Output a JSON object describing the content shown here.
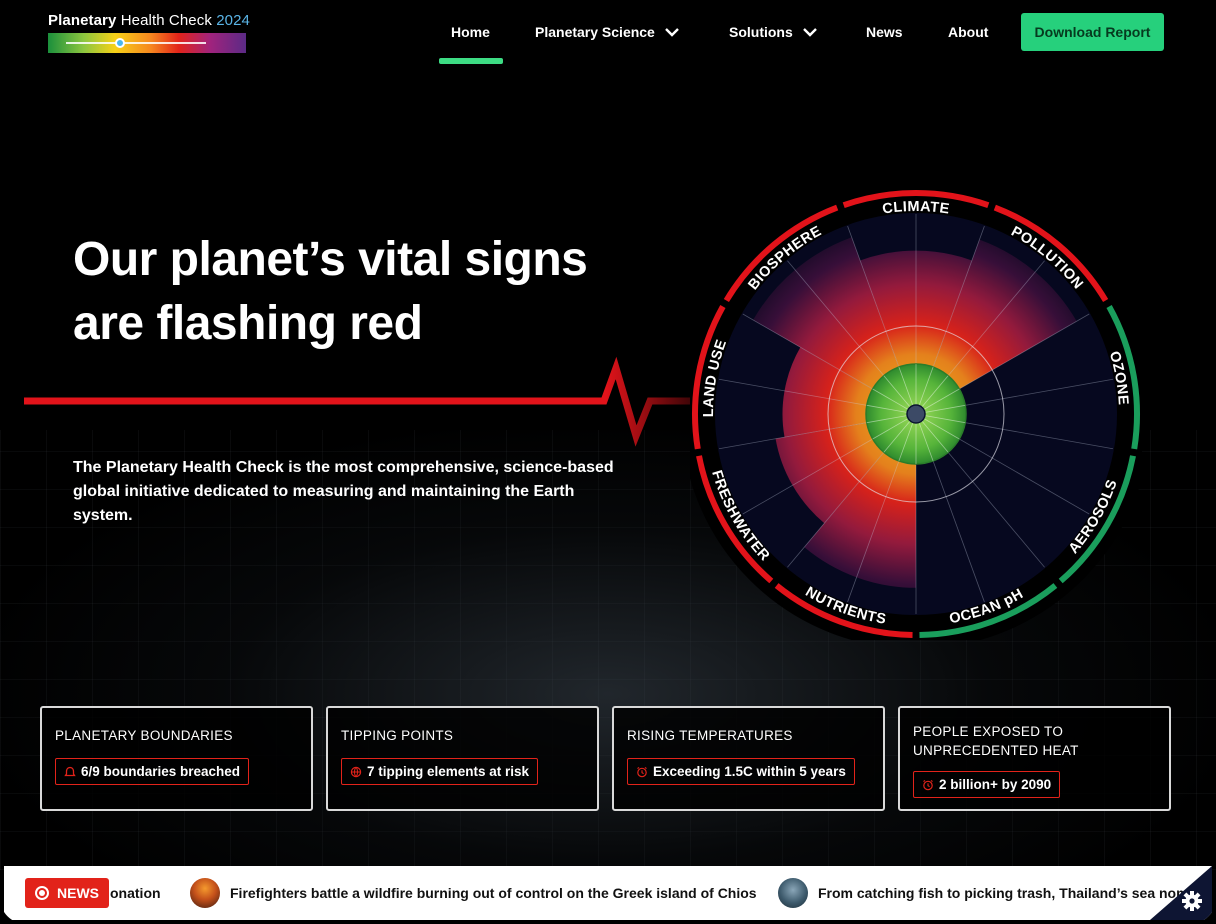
{
  "header": {
    "logo": {
      "name_bold": "Planetary",
      "name_light": " Health Check",
      "year": "2024"
    },
    "nav": [
      {
        "label": "Home",
        "has_dropdown": false,
        "active": true
      },
      {
        "label": "Planetary Science",
        "has_dropdown": true
      },
      {
        "label": "Solutions",
        "has_dropdown": true
      },
      {
        "label": "News",
        "has_dropdown": false
      },
      {
        "label": "About",
        "has_dropdown": false
      }
    ],
    "cta": "Download Report"
  },
  "hero": {
    "headline_line1": "Our planet’s vital signs",
    "headline_line2": "are flashing red",
    "subtext": "The Planetary Health Check is the most comprehensive, science-based global initiative dedicated to measuring and maintaining the Earth system."
  },
  "wheel": {
    "segments": [
      {
        "label": "CLIMATE",
        "status": "breached"
      },
      {
        "label": "POLLUTION",
        "status": "breached"
      },
      {
        "label": "OZONE",
        "status": "safe"
      },
      {
        "label": "AEROSOLS",
        "status": "safe"
      },
      {
        "label": "OCEAN pH",
        "status": "safe"
      },
      {
        "label": "NUTRIENTS",
        "status": "breached"
      },
      {
        "label": "FRESHWATER",
        "status": "breached"
      },
      {
        "label": "LAND USE",
        "status": "breached"
      },
      {
        "label": "BIOSPHERE",
        "status": "breached"
      }
    ],
    "colors": {
      "breached": "#e2131a",
      "safe": "#1a9e5c"
    }
  },
  "cards": [
    {
      "title": "PLANETARY BOUNDARIES",
      "badge": "6/9 boundaries breached",
      "icon": "alarm-icon"
    },
    {
      "title": "TIPPING POINTS",
      "badge": "7 tipping elements at risk",
      "icon": "globe-icon"
    },
    {
      "title": "RISING TEMPERATURES",
      "badge": "Exceeding 1.5C within 5 years",
      "icon": "alarm-clock-icon"
    },
    {
      "title": "PEOPLE EXPOSED TO UNPRECEDENTED HEAT",
      "badge": "2 billion+ by 2090",
      "icon": "alarm-clock-icon"
    }
  ],
  "ticker": {
    "badge": "NEWS",
    "items": [
      "onation",
      "Firefighters battle a wildfire burning out of control on the Greek island of Chios",
      "From catching fish to picking trash, Thailand’s sea nom"
    ]
  },
  "colors": {
    "accent_green": "#26d07c",
    "alert_red": "#e2231a"
  }
}
